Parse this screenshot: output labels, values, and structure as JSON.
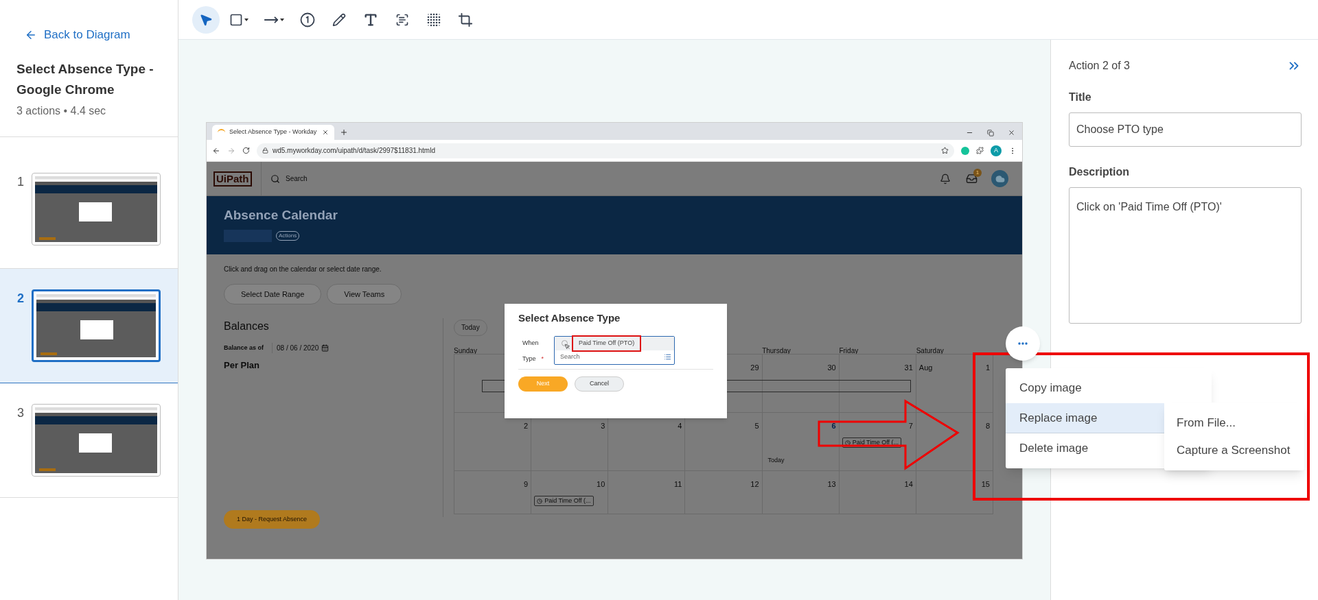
{
  "sidebar": {
    "back_link": "Back to Diagram",
    "title": "Select Absence Type - Google Chrome",
    "meta": "3 actions • 4.4 sec",
    "steps": [
      {
        "number": "1",
        "selected": false
      },
      {
        "number": "2",
        "selected": true
      },
      {
        "number": "3",
        "selected": false
      }
    ]
  },
  "toolbar": {
    "tools": [
      {
        "kind": "select",
        "selected": true
      },
      {
        "kind": "rectangle",
        "selected": false
      },
      {
        "kind": "arrow",
        "selected": false
      },
      {
        "kind": "step",
        "selected": false
      },
      {
        "kind": "pen",
        "selected": false
      },
      {
        "kind": "text",
        "selected": false
      },
      {
        "kind": "ocr",
        "selected": false
      },
      {
        "kind": "blur",
        "selected": false
      },
      {
        "kind": "crop",
        "selected": false
      }
    ]
  },
  "screenshot": {
    "browser": {
      "tab_title": "Select Absence Type - Workday",
      "url": "wd5.myworkday.com/uipath/d/task/2997$11831.htmld",
      "profile_initial": "A"
    },
    "app": {
      "logo": "UiPath",
      "search_placeholder": "Search",
      "notification_count": "1",
      "page_title": "Absence Calendar",
      "actions_label": "Actions",
      "hint": "Click and drag on the calendar or select date range.",
      "buttons": [
        "Select Date Range",
        "View Teams"
      ],
      "balances_title": "Balances",
      "balance_as_of_label": "Balance as of",
      "balance_date": "08 / 06 / 2020",
      "per_plan": "Per Plan",
      "today_button": "Today",
      "request_button": "1 Day - Request Absence"
    },
    "calendar": {
      "day_headers_left": [
        "Sunday"
      ],
      "day_headers_right": [
        "Thursday",
        "Friday",
        "Saturday"
      ],
      "weeks": [
        [
          {
            "label": "29",
            "today": false
          },
          {
            "label": "30",
            "today": false
          },
          {
            "label": "31",
            "today": false
          },
          {
            "label": "1",
            "month": "Aug",
            "today": false
          }
        ],
        [
          {
            "label": "2",
            "today": false
          },
          {
            "label": "3",
            "today": false
          },
          {
            "label": "4",
            "today": false
          },
          {
            "label": "5",
            "today": false
          },
          {
            "label": "6",
            "today": true,
            "today_label": "Today"
          },
          {
            "label": "7",
            "today": false,
            "event": "Paid Time Off (..."
          },
          {
            "label": "8",
            "today": false
          }
        ],
        [
          {
            "label": "9",
            "today": false
          },
          {
            "label": "10",
            "today": false,
            "event": "Paid Time Off (..."
          },
          {
            "label": "11",
            "today": false
          },
          {
            "label": "12",
            "today": false
          },
          {
            "label": "13",
            "today": false
          },
          {
            "label": "14",
            "today": false
          },
          {
            "label": "15",
            "today": false
          }
        ]
      ]
    },
    "dialog": {
      "title": "Select Absence Type",
      "when_label": "When",
      "when_value": "Paid Time Off (PTO)",
      "type_label": "Type",
      "required_mark": "*",
      "type_placeholder": "Search",
      "buttons": [
        {
          "label": "Next",
          "kind": "primary"
        },
        {
          "label": "Cancel",
          "kind": "secondary"
        }
      ]
    }
  },
  "details": {
    "heading": "Action 2 of 3",
    "title_label": "Title",
    "title_value": "Choose PTO type",
    "description_label": "Description",
    "description_value": "Click on 'Paid Time Off (PTO)'"
  },
  "context_menu": {
    "items": [
      {
        "label": "Copy image",
        "selected": false
      },
      {
        "label": "Replace image",
        "selected": true
      },
      {
        "label": "Delete image",
        "selected": false
      }
    ],
    "submenu": [
      "From File...",
      "Capture a Screenshot"
    ]
  }
}
